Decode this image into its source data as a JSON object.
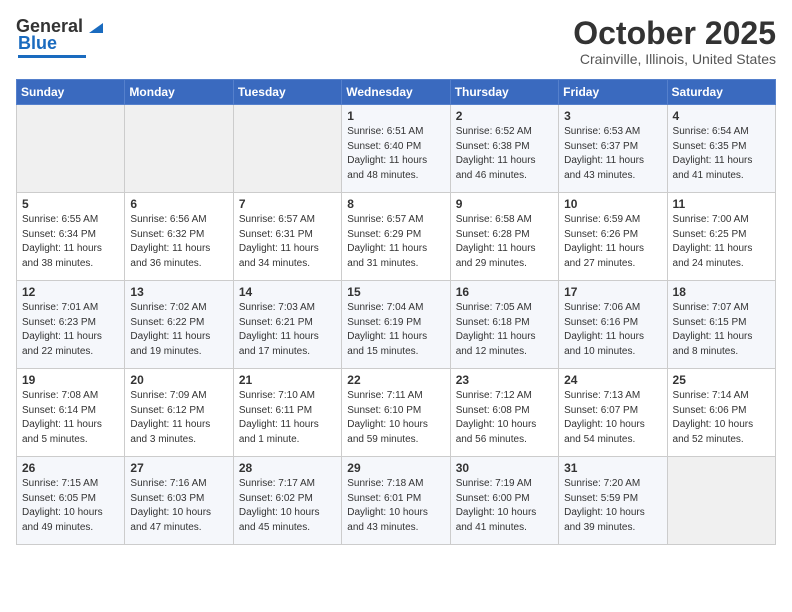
{
  "header": {
    "logo_general": "General",
    "logo_blue": "Blue",
    "month_title": "October 2025",
    "location": "Crainville, Illinois, United States"
  },
  "days_of_week": [
    "Sunday",
    "Monday",
    "Tuesday",
    "Wednesday",
    "Thursday",
    "Friday",
    "Saturday"
  ],
  "weeks": [
    [
      {
        "day": "",
        "info": ""
      },
      {
        "day": "",
        "info": ""
      },
      {
        "day": "",
        "info": ""
      },
      {
        "day": "1",
        "info": "Sunrise: 6:51 AM\nSunset: 6:40 PM\nDaylight: 11 hours\nand 48 minutes."
      },
      {
        "day": "2",
        "info": "Sunrise: 6:52 AM\nSunset: 6:38 PM\nDaylight: 11 hours\nand 46 minutes."
      },
      {
        "day": "3",
        "info": "Sunrise: 6:53 AM\nSunset: 6:37 PM\nDaylight: 11 hours\nand 43 minutes."
      },
      {
        "day": "4",
        "info": "Sunrise: 6:54 AM\nSunset: 6:35 PM\nDaylight: 11 hours\nand 41 minutes."
      }
    ],
    [
      {
        "day": "5",
        "info": "Sunrise: 6:55 AM\nSunset: 6:34 PM\nDaylight: 11 hours\nand 38 minutes."
      },
      {
        "day": "6",
        "info": "Sunrise: 6:56 AM\nSunset: 6:32 PM\nDaylight: 11 hours\nand 36 minutes."
      },
      {
        "day": "7",
        "info": "Sunrise: 6:57 AM\nSunset: 6:31 PM\nDaylight: 11 hours\nand 34 minutes."
      },
      {
        "day": "8",
        "info": "Sunrise: 6:57 AM\nSunset: 6:29 PM\nDaylight: 11 hours\nand 31 minutes."
      },
      {
        "day": "9",
        "info": "Sunrise: 6:58 AM\nSunset: 6:28 PM\nDaylight: 11 hours\nand 29 minutes."
      },
      {
        "day": "10",
        "info": "Sunrise: 6:59 AM\nSunset: 6:26 PM\nDaylight: 11 hours\nand 27 minutes."
      },
      {
        "day": "11",
        "info": "Sunrise: 7:00 AM\nSunset: 6:25 PM\nDaylight: 11 hours\nand 24 minutes."
      }
    ],
    [
      {
        "day": "12",
        "info": "Sunrise: 7:01 AM\nSunset: 6:23 PM\nDaylight: 11 hours\nand 22 minutes."
      },
      {
        "day": "13",
        "info": "Sunrise: 7:02 AM\nSunset: 6:22 PM\nDaylight: 11 hours\nand 19 minutes."
      },
      {
        "day": "14",
        "info": "Sunrise: 7:03 AM\nSunset: 6:21 PM\nDaylight: 11 hours\nand 17 minutes."
      },
      {
        "day": "15",
        "info": "Sunrise: 7:04 AM\nSunset: 6:19 PM\nDaylight: 11 hours\nand 15 minutes."
      },
      {
        "day": "16",
        "info": "Sunrise: 7:05 AM\nSunset: 6:18 PM\nDaylight: 11 hours\nand 12 minutes."
      },
      {
        "day": "17",
        "info": "Sunrise: 7:06 AM\nSunset: 6:16 PM\nDaylight: 11 hours\nand 10 minutes."
      },
      {
        "day": "18",
        "info": "Sunrise: 7:07 AM\nSunset: 6:15 PM\nDaylight: 11 hours\nand 8 minutes."
      }
    ],
    [
      {
        "day": "19",
        "info": "Sunrise: 7:08 AM\nSunset: 6:14 PM\nDaylight: 11 hours\nand 5 minutes."
      },
      {
        "day": "20",
        "info": "Sunrise: 7:09 AM\nSunset: 6:12 PM\nDaylight: 11 hours\nand 3 minutes."
      },
      {
        "day": "21",
        "info": "Sunrise: 7:10 AM\nSunset: 6:11 PM\nDaylight: 11 hours\nand 1 minute."
      },
      {
        "day": "22",
        "info": "Sunrise: 7:11 AM\nSunset: 6:10 PM\nDaylight: 10 hours\nand 59 minutes."
      },
      {
        "day": "23",
        "info": "Sunrise: 7:12 AM\nSunset: 6:08 PM\nDaylight: 10 hours\nand 56 minutes."
      },
      {
        "day": "24",
        "info": "Sunrise: 7:13 AM\nSunset: 6:07 PM\nDaylight: 10 hours\nand 54 minutes."
      },
      {
        "day": "25",
        "info": "Sunrise: 7:14 AM\nSunset: 6:06 PM\nDaylight: 10 hours\nand 52 minutes."
      }
    ],
    [
      {
        "day": "26",
        "info": "Sunrise: 7:15 AM\nSunset: 6:05 PM\nDaylight: 10 hours\nand 49 minutes."
      },
      {
        "day": "27",
        "info": "Sunrise: 7:16 AM\nSunset: 6:03 PM\nDaylight: 10 hours\nand 47 minutes."
      },
      {
        "day": "28",
        "info": "Sunrise: 7:17 AM\nSunset: 6:02 PM\nDaylight: 10 hours\nand 45 minutes."
      },
      {
        "day": "29",
        "info": "Sunrise: 7:18 AM\nSunset: 6:01 PM\nDaylight: 10 hours\nand 43 minutes."
      },
      {
        "day": "30",
        "info": "Sunrise: 7:19 AM\nSunset: 6:00 PM\nDaylight: 10 hours\nand 41 minutes."
      },
      {
        "day": "31",
        "info": "Sunrise: 7:20 AM\nSunset: 5:59 PM\nDaylight: 10 hours\nand 39 minutes."
      },
      {
        "day": "",
        "info": ""
      }
    ]
  ]
}
